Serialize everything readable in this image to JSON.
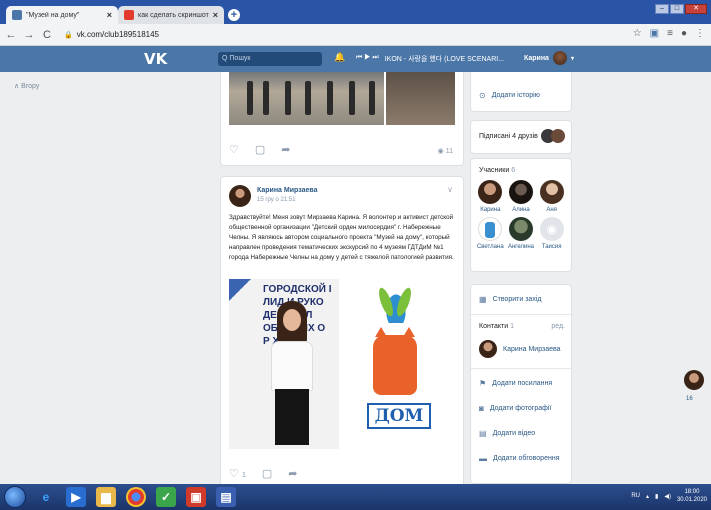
{
  "browser": {
    "tabs": [
      {
        "label": "\"Музей на дому\"",
        "close": "×"
      },
      {
        "label": "как сделать скриншот на компь",
        "close": "×"
      }
    ],
    "newtab": "+",
    "window_controls": [
      "‒",
      "□",
      "✕"
    ],
    "nav": {
      "back": "←",
      "forward": "→",
      "reload": "C"
    },
    "url": "vk.com/club189518145",
    "right_icons": [
      "☆",
      "⋮"
    ]
  },
  "vk_header": {
    "logo": "VK",
    "search_placeholder": "Q Пошук",
    "player_controls": "⏮ ▶ ⏭",
    "track": "IKON - 사랑을 했다 (LOVE SCENARI...",
    "user_name": "Карина"
  },
  "left": {
    "back_label": "Вгору"
  },
  "post1": {
    "views": "11"
  },
  "post2": {
    "author": "Карина Мирзаева",
    "date": "15 гру о 21:51",
    "text": "Здравствуйте! Меня зовут Мирзаева Карина. Я волонтер и активист детской общественной организации \"Детский орден милосердия\" г. Набережные Челны. Я являюсь автором социального проекта \"Музей на дому\", который направлен проведения тематических экскурсий по 4 музеям ГДТДиМ №1 города Набережные Челны на дому у детей с тяжелой патологией развития.",
    "image1_text": [
      "ГОРОДСКОЙ I",
      "ЛИД    И РУКО",
      "ДЕ      И МОЛ",
      "ОБЩ    НЫХ О",
      "                 Р XXI"
    ],
    "image2_text": "ДОМ",
    "likes": "1"
  },
  "right": {
    "add_story": "Додати історію",
    "subscribed": "Підписані 4 друзів",
    "members_label": "Учасники",
    "members_count": "6",
    "members": [
      "Карина",
      "Алина",
      "Аня",
      "Светлана",
      "Ангелина",
      "Таисия"
    ],
    "create_event": "Створити захід",
    "contacts_label": "Контакти",
    "contacts_count": "1",
    "contacts_edit": "ред.",
    "contact_name": "Карина Мирзаева",
    "add_link": "Додати посилання",
    "add_photo": "Додати фотографії",
    "add_video": "Додати відео",
    "add_discussion": "Додати обговорення"
  },
  "fab_count": "16",
  "taskbar": {
    "lang": "RU",
    "time": "18:00",
    "date": "30.01.2020"
  },
  "colors": {
    "vk_blue": "#4a76a8",
    "link": "#2a5885",
    "page_bg": "#edeef0",
    "taskbar": "#1b356a"
  }
}
